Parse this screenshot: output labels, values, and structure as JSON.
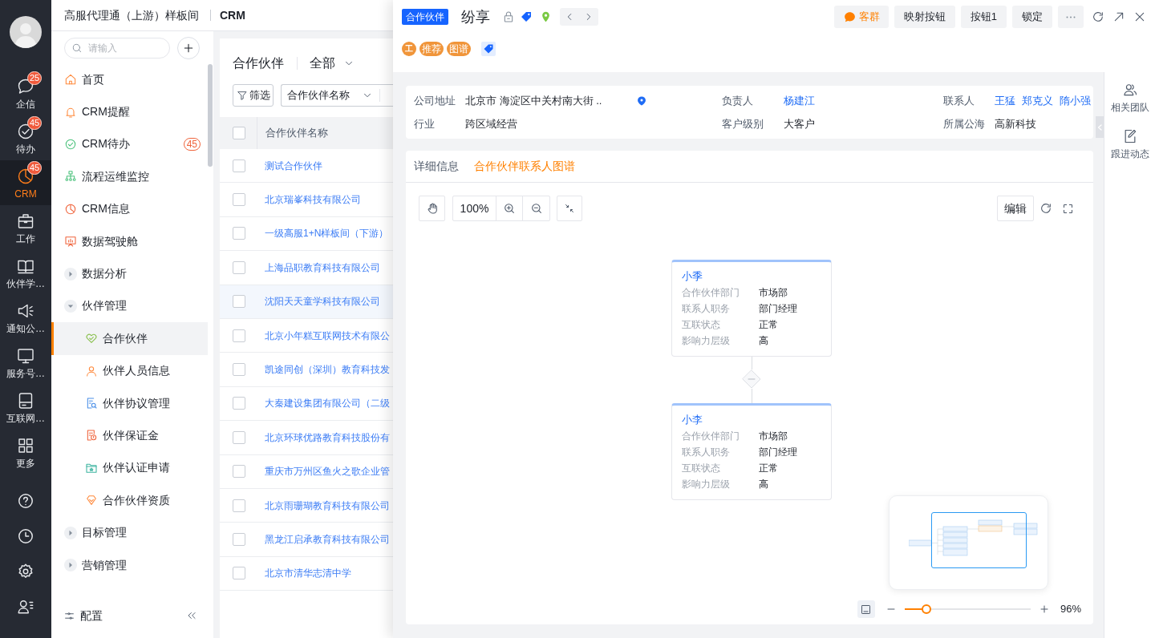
{
  "nav_rail": {
    "items": [
      {
        "label": "企信",
        "badge": "25",
        "selected": false
      },
      {
        "label": "待办",
        "badge": "45",
        "selected": false
      },
      {
        "label": "CRM",
        "badge": "45",
        "selected": true
      },
      {
        "label": "工作",
        "selected": false
      },
      {
        "label": "伙伴学…",
        "selected": false
      },
      {
        "label": "通知公…",
        "selected": false
      },
      {
        "label": "服务号…",
        "selected": false
      },
      {
        "label": "互联网…",
        "selected": false
      },
      {
        "label": "更多",
        "selected": false
      }
    ]
  },
  "header": {
    "app_name": "高服代理通（上游）样板间",
    "module": "CRM"
  },
  "sidebar": {
    "search": {
      "placeholder": "请输入"
    },
    "items": [
      {
        "kind": "link",
        "label": "首页",
        "selected": false
      },
      {
        "kind": "link",
        "label": "CRM提醒",
        "selected": false
      },
      {
        "kind": "link",
        "label": "CRM待办",
        "badge": "45",
        "selected": false
      },
      {
        "kind": "link",
        "label": "流程运维监控",
        "selected": false
      },
      {
        "kind": "link",
        "label": "CRM信息",
        "selected": false
      },
      {
        "kind": "link",
        "label": "数据驾驶舱",
        "selected": false
      },
      {
        "kind": "group",
        "label": "数据分析",
        "expanded": false,
        "selected": false
      },
      {
        "kind": "group",
        "label": "伙伴管理",
        "expanded": true,
        "selected": false,
        "children": [
          {
            "label": "合作伙伴",
            "selected": true
          },
          {
            "label": "伙伴人员信息",
            "selected": false
          },
          {
            "label": "伙伴协议管理",
            "selected": false
          },
          {
            "label": "伙伴保证金",
            "selected": false
          },
          {
            "label": "伙伴认证申请",
            "selected": false
          },
          {
            "label": "合作伙伴资质",
            "selected": false
          }
        ]
      },
      {
        "kind": "group",
        "label": "目标管理",
        "expanded": false,
        "selected": false
      },
      {
        "kind": "group",
        "label": "营销管理",
        "expanded": false,
        "selected": false
      }
    ],
    "footer": {
      "label": "配置"
    }
  },
  "list_panel": {
    "title": "合作伙伴",
    "view": "全部",
    "filter_button": "筛选",
    "field_select": "合作伙伴名称",
    "table": {
      "header_checked": false,
      "columns": [
        "合作伙伴名称"
      ],
      "rows": [
        {
          "name": "测试合作伙伴",
          "checked": false,
          "hovered": false
        },
        {
          "name": "北京瑞峯科技有限公司",
          "checked": false,
          "hovered": false
        },
        {
          "name": "一级高服1+N样板间（下游）",
          "checked": false,
          "hovered": false
        },
        {
          "name": "上海品职教育科技有限公司",
          "checked": false,
          "hovered": false
        },
        {
          "name": "沈阳天天童学科技有限公司",
          "checked": false,
          "hovered": true
        },
        {
          "name": "北京小年糕互联网技术有限公",
          "checked": false,
          "hovered": false
        },
        {
          "name": "凯途同创（深圳）教育科技发",
          "checked": false,
          "hovered": false
        },
        {
          "name": "大秦建设集团有限公司（二级",
          "checked": false,
          "hovered": false
        },
        {
          "name": "北京环球优路教育科技股份有",
          "checked": false,
          "hovered": false
        },
        {
          "name": "重庆市万州区鱼火之歌企业管",
          "checked": false,
          "hovered": false
        },
        {
          "name": "北京雨珊瑚教育科技有限公司",
          "checked": false,
          "hovered": false
        },
        {
          "name": "黑龙江启承教育科技有限公司",
          "checked": false,
          "hovered": false
        },
        {
          "name": "北京市清华志清中学",
          "checked": false,
          "hovered": false
        }
      ]
    }
  },
  "detail": {
    "type_badge": "合作伙伴",
    "title": "纷享",
    "actions": [
      {
        "kind": "accent",
        "label": "客群"
      },
      {
        "kind": "plain",
        "label": "映射按钮"
      },
      {
        "kind": "plain",
        "label": "按钮1"
      },
      {
        "kind": "plain",
        "label": "锁定"
      }
    ],
    "tags": [
      {
        "kind": "circle",
        "label": "工"
      },
      {
        "kind": "pill",
        "label": "推荐"
      },
      {
        "kind": "pill",
        "label": "图谱"
      }
    ],
    "summary": [
      {
        "kind": "address",
        "label": "公司地址",
        "value": "北京市 海淀区中关村南大街 .."
      },
      {
        "kind": "links",
        "label": "负责人",
        "values": [
          "杨建江"
        ]
      },
      {
        "kind": "links",
        "label": "联系人",
        "values": [
          "王猛",
          "郑克义",
          "隋小强"
        ]
      },
      {
        "kind": "text",
        "label": "行业",
        "value": "跨区域经营"
      },
      {
        "kind": "text",
        "label": "客户级别",
        "value": "大客户"
      },
      {
        "kind": "text",
        "label": "所属公海",
        "value": "高新科技"
      }
    ],
    "tabs": [
      {
        "label": "详细信息",
        "selected": false
      },
      {
        "label": "合作伙伴联系人图谱",
        "selected": true
      }
    ],
    "graph": {
      "zoom": "100%",
      "edit_button": "编辑",
      "root": {
        "name": "小季",
        "expanded": true,
        "fields": [
          {
            "label": "合作伙伴部门",
            "value": "市场部"
          },
          {
            "label": "联系人职务",
            "value": "部门经理"
          },
          {
            "label": "互联状态",
            "value": "正常"
          },
          {
            "label": "影响力层级",
            "value": "高"
          }
        ],
        "children": [
          {
            "name": "小李",
            "fields": [
              {
                "label": "合作伙伴部门",
                "value": "市场部"
              },
              {
                "label": "联系人职务",
                "value": "部门经理"
              },
              {
                "label": "互联状态",
                "value": "正常"
              },
              {
                "label": "影响力层级",
                "value": "高"
              }
            ]
          }
        ]
      },
      "zoom_slider": {
        "level": 0.17,
        "reading": "96%"
      }
    }
  },
  "side_rail": {
    "items": [
      {
        "label": "相关团队"
      },
      {
        "label": "跟进动态"
      }
    ]
  }
}
